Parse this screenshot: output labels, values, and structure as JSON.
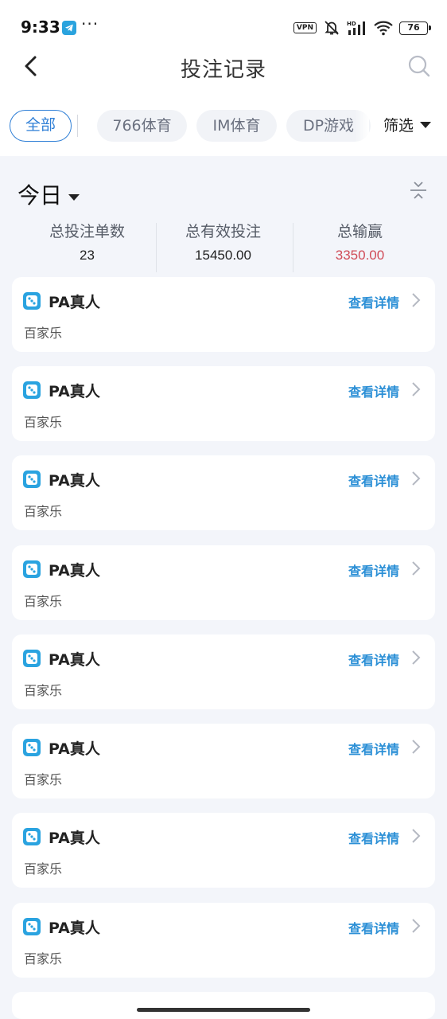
{
  "status_bar": {
    "time": "9:33",
    "dots": "···",
    "vpn": "VPN",
    "battery": "76"
  },
  "nav": {
    "title": "投注记录"
  },
  "tabs": [
    {
      "label": "全部",
      "active": true
    },
    {
      "label": "766体育",
      "active": false
    },
    {
      "label": "IM体育",
      "active": false
    },
    {
      "label": "DP游戏",
      "active": false
    }
  ],
  "filter_label": "筛选",
  "summary": {
    "date_label": "今日",
    "stats": [
      {
        "label": "总投注单数",
        "value": "23"
      },
      {
        "label": "总有效投注",
        "value": "15450.00"
      },
      {
        "label": "总输赢",
        "value": "3350.00"
      }
    ]
  },
  "records": [
    {
      "title": "PA真人",
      "subtitle": "百家乐",
      "link": "查看详情"
    },
    {
      "title": "PA真人",
      "subtitle": "百家乐",
      "link": "查看详情"
    },
    {
      "title": "PA真人",
      "subtitle": "百家乐",
      "link": "查看详情"
    },
    {
      "title": "PA真人",
      "subtitle": "百家乐",
      "link": "查看详情"
    },
    {
      "title": "PA真人",
      "subtitle": "百家乐",
      "link": "查看详情"
    },
    {
      "title": "PA真人",
      "subtitle": "百家乐",
      "link": "查看详情"
    },
    {
      "title": "PA真人",
      "subtitle": "百家乐",
      "link": "查看详情"
    },
    {
      "title": "PA真人",
      "subtitle": "百家乐",
      "link": "查看详情"
    }
  ],
  "colors": {
    "accent": "#2f7fd6",
    "link": "#2b8fd6",
    "loss_win": "#d04b57",
    "background": "#f3f5fa"
  }
}
